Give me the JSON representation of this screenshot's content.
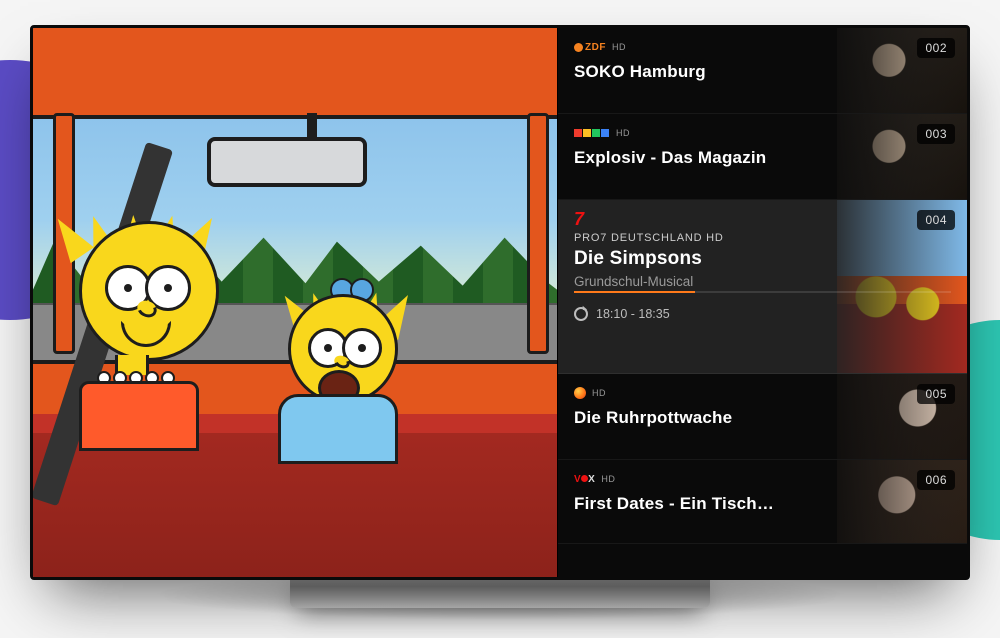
{
  "channels": [
    {
      "number": "002",
      "logo_text": "ZDF",
      "hd_label": "HD",
      "title": "SOKO Hamburg"
    },
    {
      "number": "003",
      "logo_text": "RTLZWEI",
      "hd_label": "HD",
      "title": "Explosiv - Das Magazin"
    },
    {
      "number": "004",
      "channel_name": "PRO7 DEUTSCHLAND HD",
      "title": "Die Simpsons",
      "subtitle": "Grundschul-Musical",
      "time": "18:10 - 18:35",
      "selected": true
    },
    {
      "number": "005",
      "logo_text": "",
      "hd_label": "HD",
      "title": "Die Ruhrpottwache"
    },
    {
      "number": "006",
      "logo_text": "VOX",
      "hd_label": "HD",
      "title": "First Dates - Ein Tisch…"
    }
  ],
  "progress_percent": 32
}
